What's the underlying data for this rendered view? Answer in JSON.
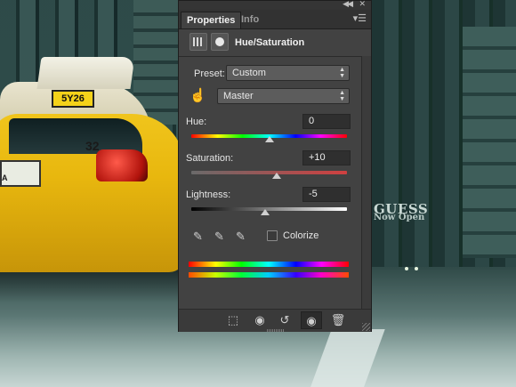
{
  "background": {
    "taxi_tag": "5Y26",
    "taxi_number": "32",
    "plate_text": "A",
    "store_sign": "GUESS",
    "store_subsign": "Now Open"
  },
  "panel": {
    "tabs": [
      {
        "label": "Properties",
        "active": true
      },
      {
        "label": "Info",
        "active": false
      }
    ],
    "title": "Hue/Saturation",
    "preset": {
      "label": "Preset:",
      "value": "Custom"
    },
    "channel": {
      "value": "Master"
    },
    "sliders": {
      "hue": {
        "label": "Hue:",
        "value": "0",
        "range": [
          -180,
          180
        ],
        "level": 0
      },
      "saturation": {
        "label": "Saturation:",
        "value": "+10",
        "range": [
          -100,
          100
        ],
        "level": 10
      },
      "lightness": {
        "label": "Lightness:",
        "value": "-5",
        "range": [
          -100,
          100
        ],
        "level": -5
      }
    },
    "colorize": {
      "label": "Colorize",
      "checked": false
    },
    "icons": {
      "header": [
        "adjustment-icon",
        "mask-icon"
      ],
      "tools": [
        "hand-target-icon",
        "eyedropper-icon",
        "eyedropper-plus-icon",
        "eyedropper-minus-icon"
      ],
      "footer": [
        "clip-to-layer-icon",
        "view-previous-icon",
        "reset-icon",
        "visibility-icon",
        "trash-icon"
      ]
    }
  }
}
